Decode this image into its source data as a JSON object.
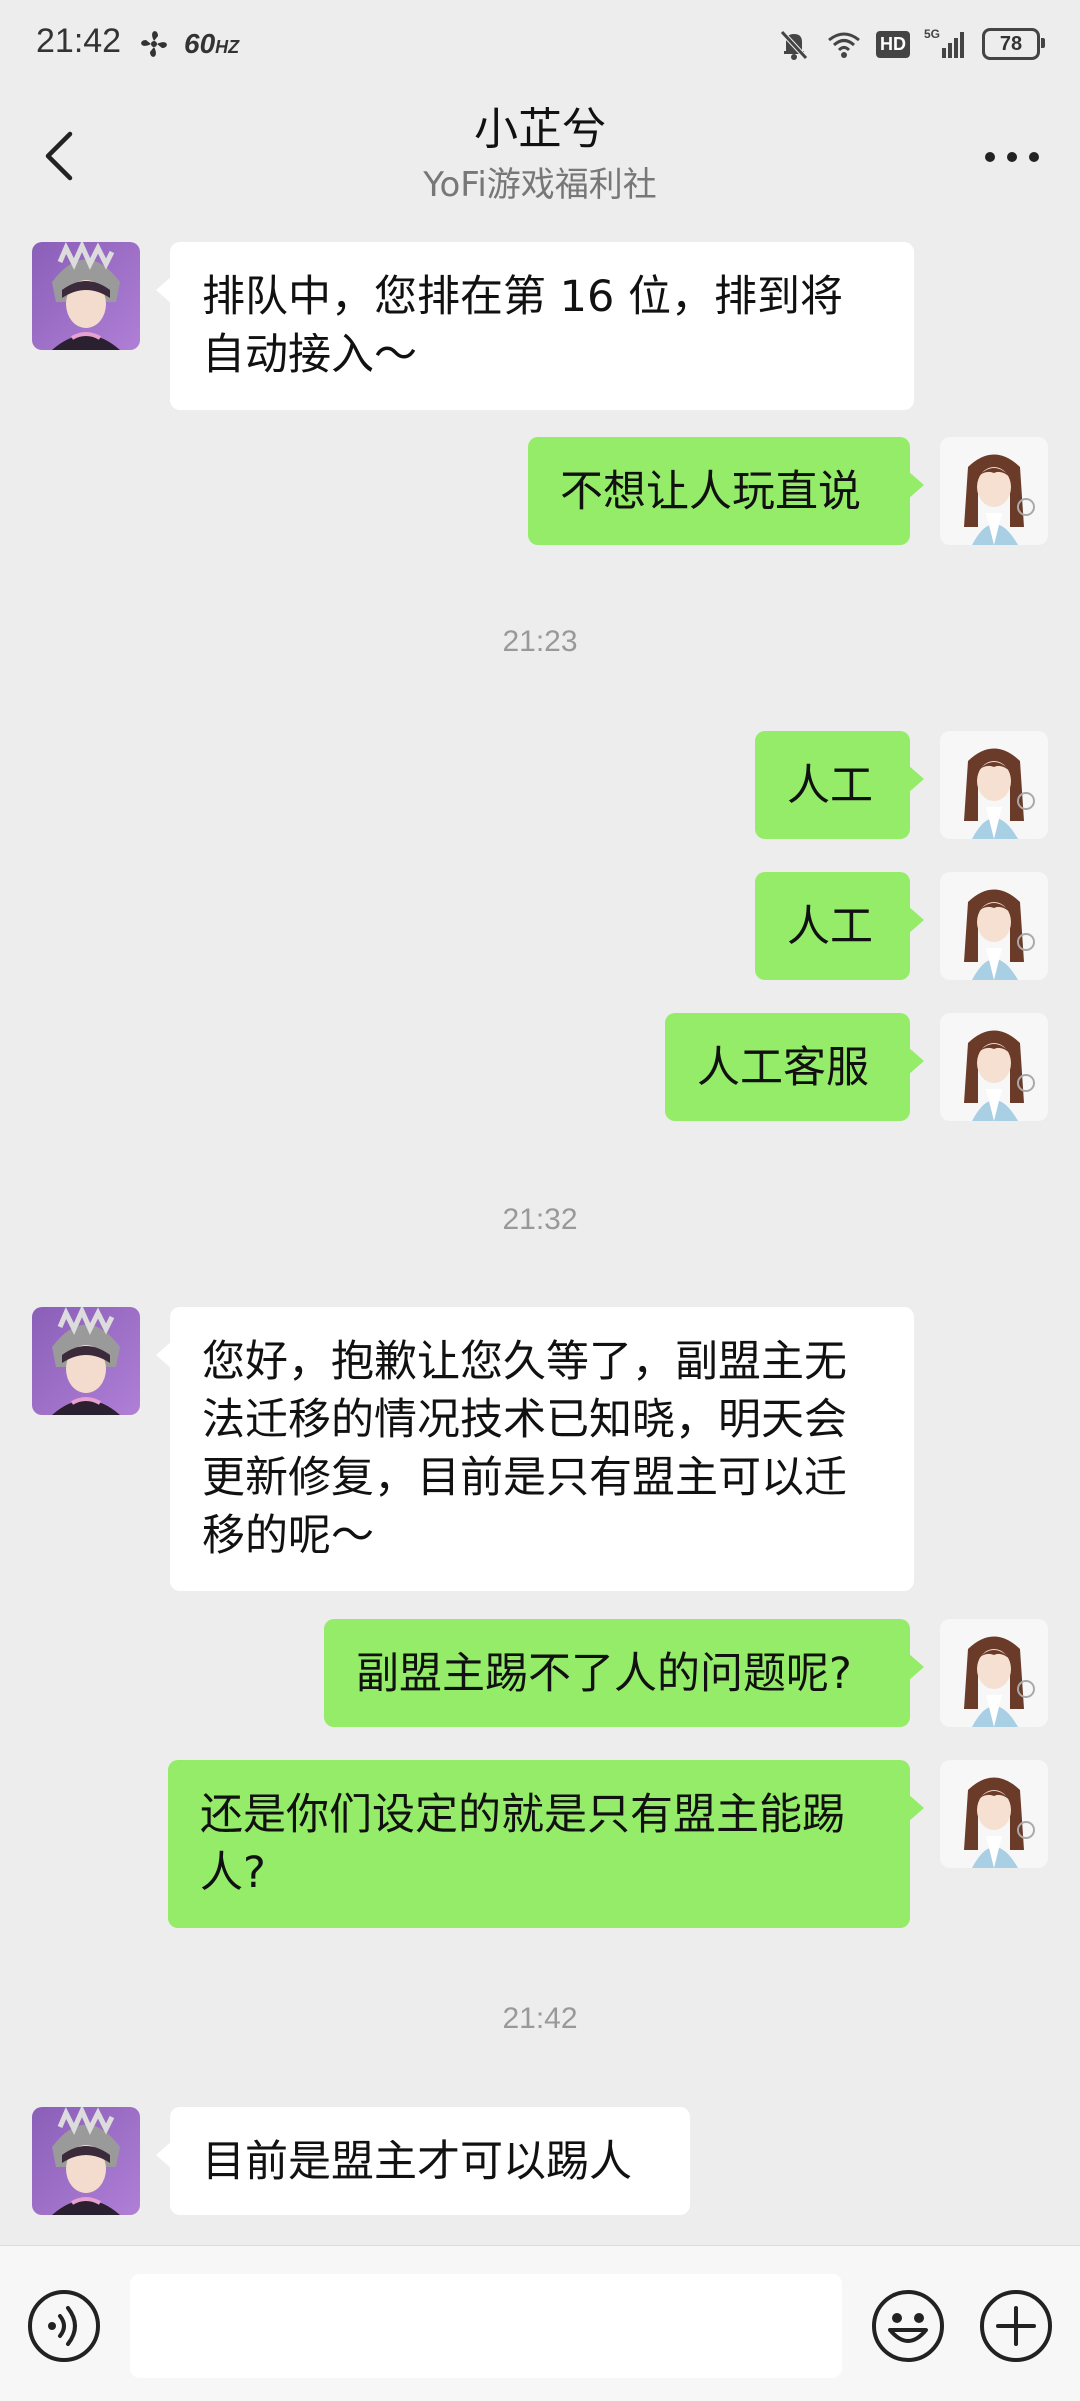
{
  "status_bar": {
    "time": "21:42",
    "refresh_rate": "60",
    "refresh_unit": "HZ",
    "network": "5G",
    "hd_badge": "HD",
    "battery": "78"
  },
  "header": {
    "title": "小芷兮",
    "subtitle": "YoFi游戏福利社"
  },
  "messages": [
    {
      "side": "in",
      "text": "排队中，您排在第 16 位，排到将自动接入～"
    },
    {
      "side": "out",
      "text": "不想让人玩直说"
    },
    {
      "timestamp": "21:23"
    },
    {
      "side": "out",
      "text": "人工"
    },
    {
      "side": "out",
      "text": "人工"
    },
    {
      "side": "out",
      "text": "人工客服"
    },
    {
      "timestamp": "21:32"
    },
    {
      "side": "in",
      "text": "您好，抱歉让您久等了，副盟主无法迁移的情况技术已知晓，明天会更新修复，目前是只有盟主可以迁移的呢～"
    },
    {
      "side": "out",
      "text": "副盟主踢不了人的问题呢?"
    },
    {
      "side": "out",
      "text": "还是你们设定的就是只有盟主能踢人?"
    },
    {
      "timestamp": "21:42"
    },
    {
      "side": "in",
      "text": "目前是盟主才可以踢人"
    }
  ],
  "colors": {
    "background": "#EDEDED",
    "outgoing_bubble": "#95EC69",
    "incoming_bubble": "#FFFFFF",
    "timestamp_text": "#999999"
  },
  "icons": {
    "back": "chevron-left-icon",
    "more": "more-dots-icon",
    "voice": "voice-icon",
    "emoji": "emoji-icon",
    "plus": "plus-icon"
  }
}
